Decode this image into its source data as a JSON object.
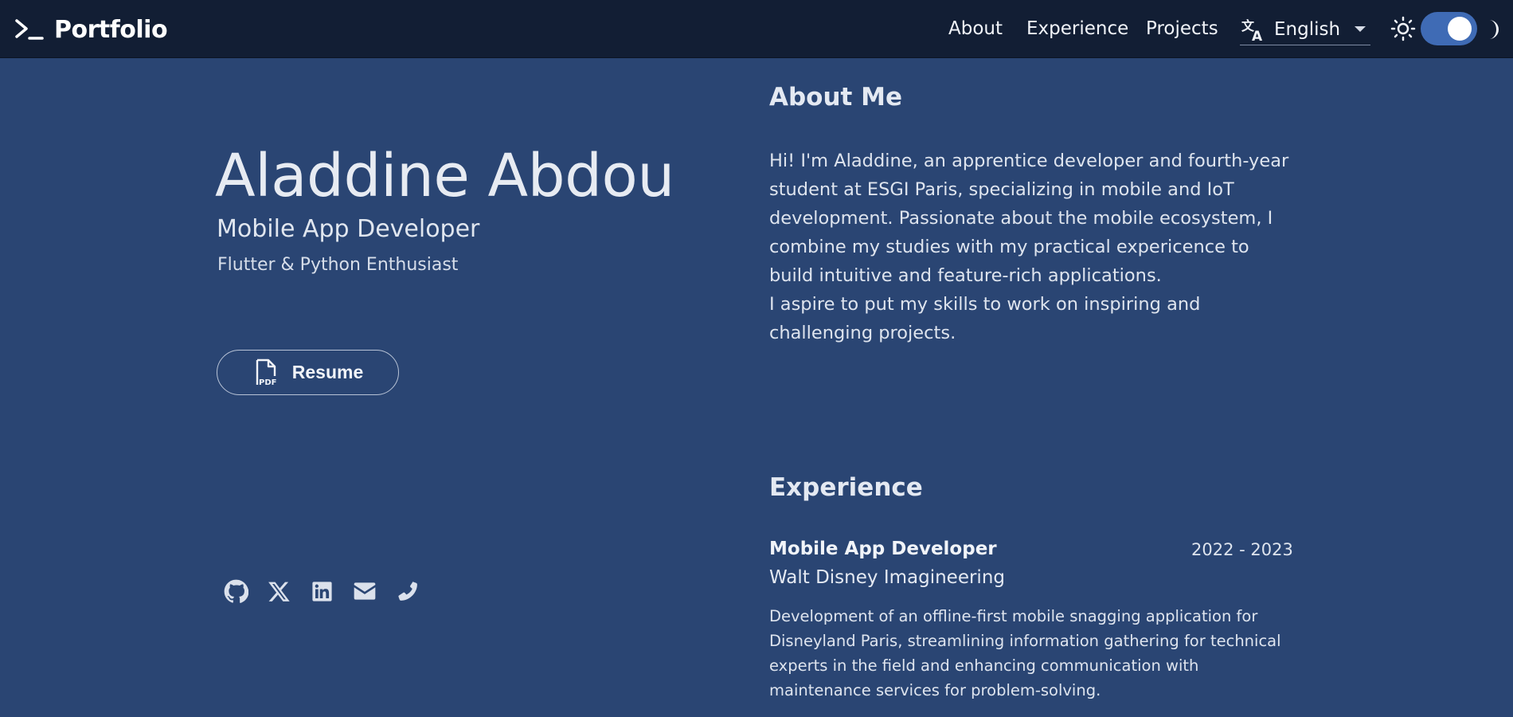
{
  "navbar": {
    "brand": "Portfolio",
    "links": [
      {
        "label": "About"
      },
      {
        "label": "Experience"
      },
      {
        "label": "Projects"
      }
    ],
    "language": {
      "selected": "English",
      "icon": "translate-icon"
    },
    "theme_toggle": {
      "state": "dark",
      "light_icon": "sun-icon",
      "dark_icon": "moon-icon"
    }
  },
  "hero": {
    "name": "Aladdine Abdou",
    "role": "Mobile App Developer",
    "tagline": "Flutter & Python Enthusiast",
    "resume_label": "Resume",
    "socials": [
      {
        "icon": "github-icon"
      },
      {
        "icon": "x-icon"
      },
      {
        "icon": "linkedin-icon"
      },
      {
        "icon": "mail-icon"
      },
      {
        "icon": "phone-icon"
      }
    ]
  },
  "about": {
    "title": "About Me",
    "paragraphs": [
      "Hi! I'm Aladdine, an apprentice developer and fourth-year student at ESGI Paris, specializing in mobile and IoT development. Passionate about the mobile ecosystem, I combine my studies with my practical expericence to build intuitive and feature-rich applications.",
      "I aspire to put my skills to work on inspiring and challenging projects."
    ]
  },
  "experience": {
    "title": "Experience",
    "items": [
      {
        "title": "Mobile App Developer",
        "dates": "2022 - 2023",
        "company": "Walt Disney Imagineering",
        "description": "Development of an offline-first mobile snagging application for Disneyland Paris, streamlining information gathering for technical experts in the field and enhancing communication with maintenance services for problem-solving."
      }
    ]
  },
  "colors": {
    "background": "#2a4573",
    "navbar": "#121e34",
    "toggle": "#3f6bb5"
  }
}
